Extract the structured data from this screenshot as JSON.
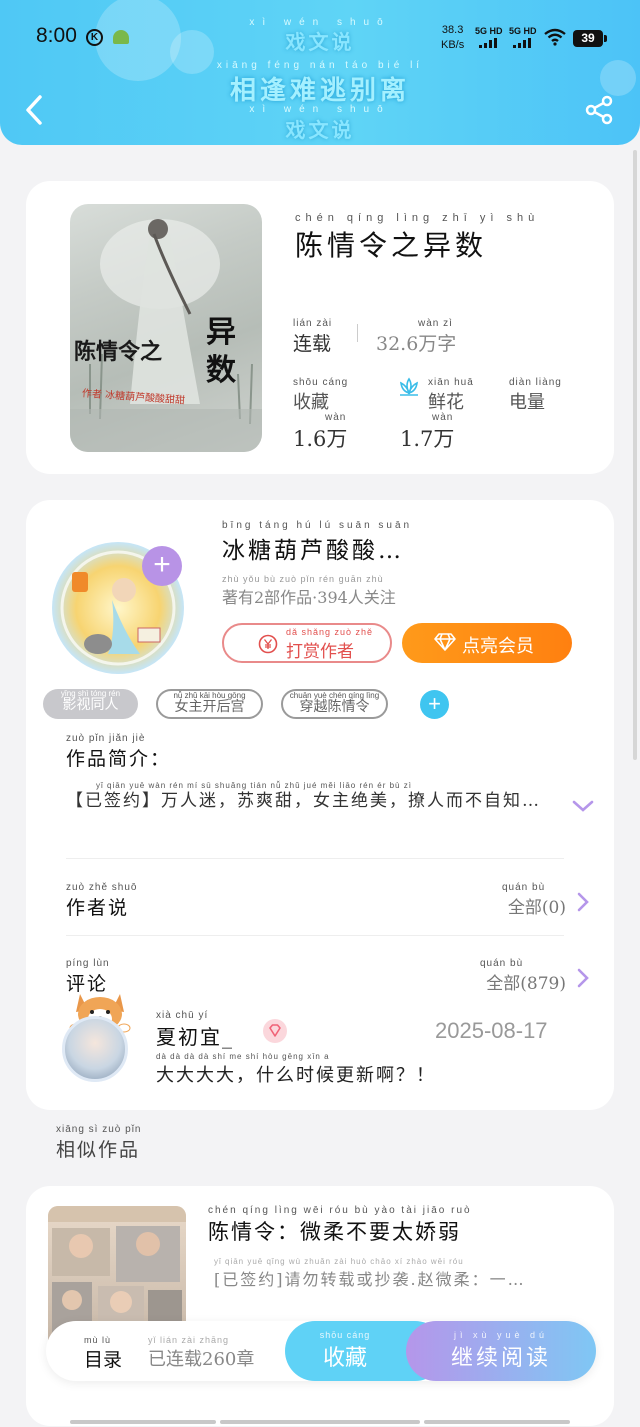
{
  "status_bar": {
    "time": "8:00",
    "net_speed_value": "38.3",
    "net_speed_unit": "KB/s",
    "sim1": "5G HD",
    "sim2": "5G HD",
    "battery": "39"
  },
  "header": {
    "banner_top": "戏文说",
    "banner_top_pinyin": "xì wén shuō",
    "banner_main": "相逢难逃别离",
    "banner_main_pinyin": "xiāng féng nán táo bié lí",
    "banner_bottom": "戏文说",
    "banner_bottom_pinyin": "xì wén shuō"
  },
  "book": {
    "cover_title": "陈情令之",
    "cover_title_big": "异数",
    "cover_subtitle": "作者 冰糖葫芦酸酸甜甜",
    "title": "陈情令之异数",
    "title_pinyin": "chén qíng lìng zhī yì shù",
    "status": "连载",
    "status_pinyin": "lián zài",
    "word_count": "32.6万字",
    "word_count_pinyin": "wàn zì",
    "stats": [
      {
        "label": "收藏",
        "label_pinyin": "shōu cáng",
        "value": "1.6万",
        "value_pinyin": "wàn"
      },
      {
        "label": "鲜花",
        "label_pinyin": "xiān huā",
        "value": "1.7万",
        "value_pinyin": "wàn"
      },
      {
        "label": "电量",
        "label_pinyin": "diàn liàng",
        "value": "",
        "value_pinyin": ""
      }
    ]
  },
  "author": {
    "name": "冰糖葫芦酸酸…",
    "name_pinyin": "bīng táng hú lú suān suān",
    "stats": "著有2部作品·394人关注",
    "stats_pinyin": "zhù yǒu  bù zuò pǐn    rén guān zhù",
    "tip_label": "打赏作者",
    "tip_pinyin": "dǎ shǎng zuò zhě",
    "vip_label": "点亮会员"
  },
  "tags": [
    {
      "label": "影视同人",
      "pinyin": "yǐng shì tóng rén"
    },
    {
      "label": "女主开后宫",
      "pinyin": "nǚ zhǔ kāi hòu gōng"
    },
    {
      "label": "穿越陈情令",
      "pinyin": "chuān yuè chén qíng lìng"
    }
  ],
  "synopsis": {
    "title": "作品简介：",
    "title_pinyin": "zuò pǐn jiǎn jiè",
    "text": "【已签约】万人迷，苏爽甜，女主绝美，撩人而不自知…",
    "text_pinyin": "yǐ qiān yuē   wàn rén mí   sū shuǎng tián   nǚ zhǔ jué měi   liāo rén ér bù zì"
  },
  "author_says": {
    "title": "作者说",
    "title_pinyin": "zuò zhě shuō",
    "count": "全部(0)",
    "count_pinyin": "quán bù"
  },
  "comments": {
    "title": "评论",
    "title_pinyin": "píng lùn",
    "count": "全部(879)",
    "count_pinyin": "quán bù",
    "items": [
      {
        "name": "夏初宜_",
        "name_pinyin": "xià chū yí",
        "date": "2025-08-17",
        "text": "大大大大，什么时候更新啊？！",
        "text_pinyin": "dà dà dà dà   shí me shí hòu gēng xīn a"
      }
    ]
  },
  "similar": {
    "title": "相似作品",
    "title_pinyin": "xiāng sì zuò pǐn",
    "items": [
      {
        "title": "陈情令：微柔不要太娇弱",
        "title_pinyin": "chén qíng lìng    wēi róu bù yào tài jiāo ruò",
        "desc": "[已签约]请勿转载或抄袭.赵微柔：一…",
        "desc_pinyin": "yǐ qiān yuē  qǐng wù zhuǎn zài huò chāo xí zhào wēi róu"
      }
    ]
  },
  "bottom_bar": {
    "toc": "目录",
    "toc_pinyin": "mù lù",
    "chapters": "已连载260章",
    "chapters_pinyin": "yǐ lián zài    zhāng",
    "collect": "收藏",
    "collect_pinyin": "shōu cáng",
    "read": "继续阅读",
    "read_pinyin": "jì xù yuè dú"
  },
  "colors": {
    "header": "#4fc8f5",
    "vip_orange": "#ff8a14",
    "tip_red": "#e2504e",
    "read_purple": "#b596ea",
    "collect_blue": "#5fd2f6"
  }
}
